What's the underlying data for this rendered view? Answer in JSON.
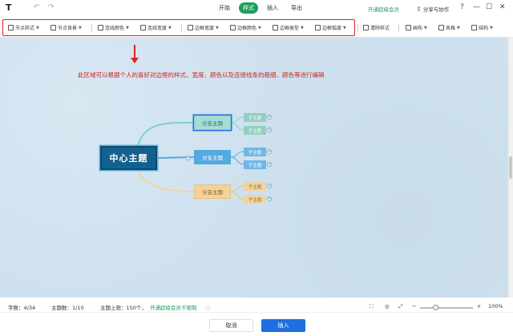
{
  "topbar": {
    "tabs": [
      {
        "label": "开始",
        "active": false
      },
      {
        "label": "样式",
        "active": true
      },
      {
        "label": "插入",
        "active": false
      },
      {
        "label": "导出",
        "active": false
      }
    ],
    "vip_label": "开通超级会员",
    "share_label": "分享与协作",
    "help": "?",
    "minimize": "—",
    "maximize": "☐",
    "close": "✕"
  },
  "toolbar": {
    "items": [
      {
        "label": "节点样式",
        "icon": "node-style-icon"
      },
      {
        "label": "节点背景",
        "icon": "node-bg-icon"
      },
      {
        "label": "连线颜色",
        "icon": "line-color-icon"
      },
      {
        "label": "连线宽度",
        "icon": "line-width-icon"
      },
      {
        "label": "边框宽度",
        "icon": "border-width-icon"
      },
      {
        "label": "边框颜色",
        "icon": "border-color-icon"
      },
      {
        "label": "边框类型",
        "icon": "border-type-icon"
      },
      {
        "label": "边框弧度",
        "icon": "border-radius-icon"
      },
      {
        "label": "清除样式",
        "icon": "clear-style-icon"
      },
      {
        "label": "画布",
        "icon": "canvas-icon"
      },
      {
        "label": "风格",
        "icon": "theme-icon"
      },
      {
        "label": "结构",
        "icon": "structure-icon"
      }
    ]
  },
  "annotation": "此区域可以根据个人的喜好对边框的样式、宽度、颜色以及连接线条的粗细、颜色等进行编辑",
  "mindmap": {
    "central": "中心主题",
    "branches": [
      {
        "label": "分支主题",
        "subs": [
          "子主题",
          "子主题"
        ]
      },
      {
        "label": "分支主题",
        "subs": [
          "子主题",
          "子主题"
        ]
      },
      {
        "label": "分支主题",
        "subs": [
          "子主题",
          "子主题"
        ]
      }
    ]
  },
  "status": {
    "chars": "字数：4/34",
    "topics": "主题数：1/10",
    "limit": "主题上限：150个，",
    "vip_link": "开通超级会员不限制",
    "zoom": "100%",
    "zoom_level": 1.0
  },
  "footer": {
    "cancel": "取消",
    "insert": "插入"
  },
  "colors": {
    "accent": "#1d9d5c",
    "primary_button": "#1e6fe0",
    "annotation_red": "#e02020",
    "central_node": "#14608e"
  }
}
